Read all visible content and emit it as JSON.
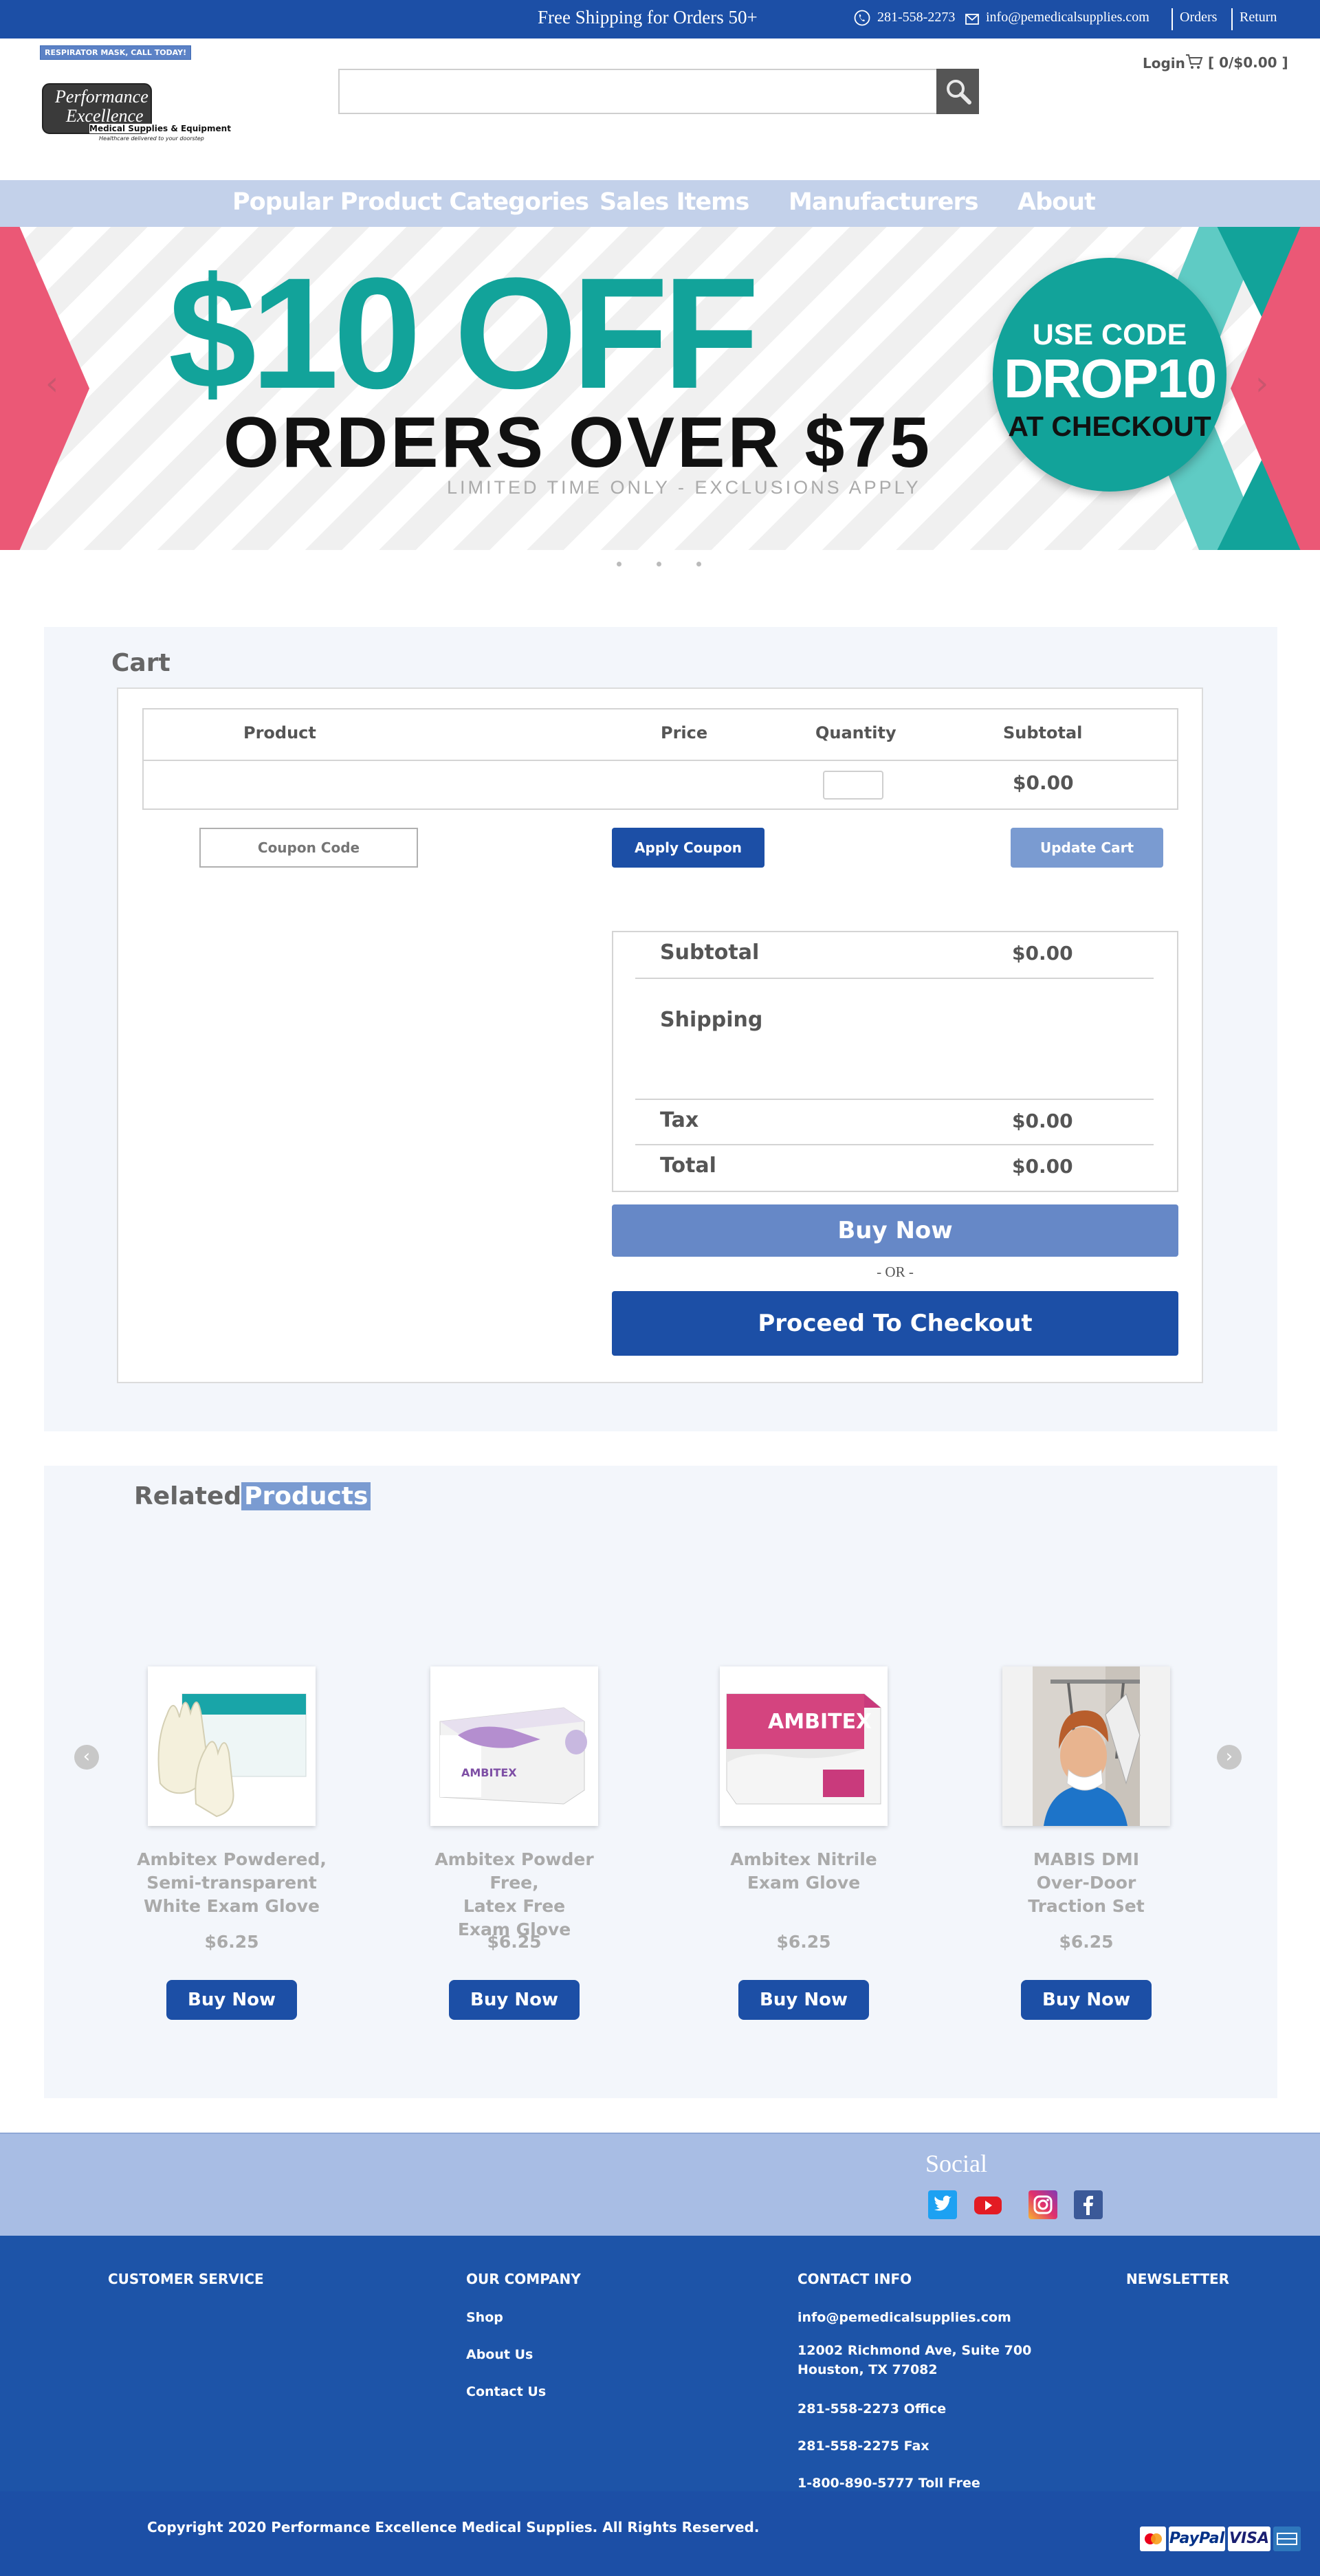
{
  "topbar": {
    "promo": "Free Shipping for Orders 50+",
    "phone": "281-558-2273",
    "email": "info@pemedicalsupplies.com",
    "orders": "Orders",
    "returns": "Return"
  },
  "header": {
    "badge": "RESPIRATOR MASK, CALL TODAY!",
    "logo_text_1": "Performance",
    "logo_text_2": "Excellence",
    "logo_text_3": "Medical Supplies & Equipment",
    "logo_tagline": "Healthcare delivered to your doorstep",
    "search_placeholder": "",
    "login": "Login",
    "cart_summary": "[ 0/$0.00 ]"
  },
  "nav": {
    "items": [
      "Popular Product Categories",
      "Sales Items",
      "Manufacturers",
      "About"
    ]
  },
  "banner": {
    "headline": "$10 OFF",
    "subheadline": "ORDERS OVER $75",
    "disclaimer": "LIMITED TIME ONLY - EXCLUSIONS APPLY",
    "code_line_1": "USE CODE",
    "code": "DROP10",
    "code_line_3": "AT CHECKOUT",
    "slides": 3
  },
  "cart": {
    "title": "Cart",
    "columns": [
      "Product",
      "Price",
      "Quantity",
      "Subtotal"
    ],
    "row_subtotal": "$0.00",
    "qty_value": "",
    "coupon_placeholder": "Coupon Code",
    "apply_coupon": "Apply Coupon",
    "update_cart": "Update Cart",
    "totals": {
      "subtotal_label": "Subtotal",
      "subtotal_value": "$0.00",
      "shipping_label": "Shipping",
      "tax_label": "Tax",
      "tax_value": "$0.00",
      "total_label": "Total",
      "total_value": "$0.00"
    },
    "buy_now": "Buy Now",
    "or": "- OR -",
    "checkout": "Proceed To Checkout"
  },
  "related": {
    "title_part_1": "Related",
    "title_part_2": "Products",
    "products": [
      {
        "name_1": "Ambitex Powdered,",
        "name_2": "Semi-transparent",
        "name_3": "White Exam Glove",
        "price": "$6.25",
        "buy": "Buy Now"
      },
      {
        "name_1": "Ambitex Powder Free,",
        "name_2": "Latex Free",
        "name_3": "Exam Glove",
        "price": "$6.25",
        "buy": "Buy Now"
      },
      {
        "name_1": "Ambitex Nitrile",
        "name_2": "Exam Glove",
        "name_3": "",
        "price": "$6.25",
        "buy": "Buy Now",
        "box_brand": "AMBITEX"
      },
      {
        "name_1": "MABIS DMI",
        "name_2": "Over-Door",
        "name_3": "Traction Set",
        "price": "$6.25",
        "buy": "Buy Now"
      }
    ],
    "box_brand": "AMBITEX"
  },
  "footer": {
    "social_title": "Social",
    "customer_service": "CUSTOMER SERVICE",
    "our_company": "OUR COMPANY",
    "company_links": [
      "Shop",
      "About Us",
      "Contact Us"
    ],
    "contact_info": "CONTACT INFO",
    "contact_email": "info@pemedicalsupplies.com",
    "address_1": "12002 Richmond Ave, Suite 700",
    "address_2": "Houston, TX 77082",
    "office": "281-558-2273 Office",
    "fax": "281-558-2275 Fax",
    "toll_free": "1-800-890-5777 Toll Free",
    "newsletter": "NEWSLETTER",
    "copyright": "Copyright 2020 Performance Excellence Medical Supplies. All Rights Reserved.",
    "pay_methods": [
      "PayPal",
      "VISA"
    ]
  },
  "colors": {
    "brand_blue": "#1c4fa6",
    "light_blue": "#7a9bd1",
    "teal": "#12a39a",
    "pink": "#eb5876"
  }
}
